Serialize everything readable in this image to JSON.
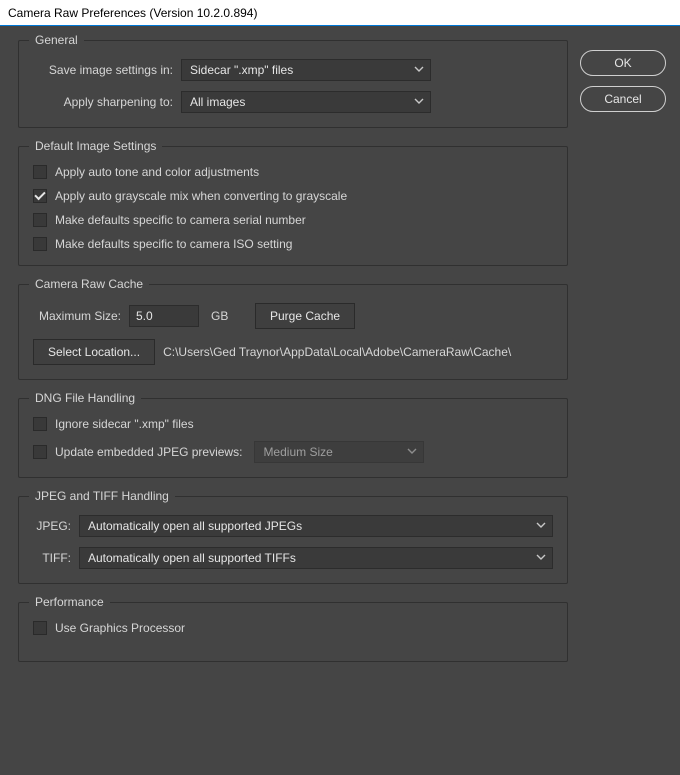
{
  "window": {
    "title": "Camera Raw Preferences  (Version 10.2.0.894)"
  },
  "buttons": {
    "ok": "OK",
    "cancel": "Cancel"
  },
  "general": {
    "legend": "General",
    "save_label": "Save image settings in:",
    "save_value": "Sidecar \".xmp\" files",
    "sharpen_label": "Apply sharpening to:",
    "sharpen_value": "All images"
  },
  "defaults": {
    "legend": "Default Image Settings",
    "auto_tone": "Apply auto tone and color adjustments",
    "auto_gray": "Apply auto grayscale mix when converting to grayscale",
    "specific_serial": "Make defaults specific to camera serial number",
    "specific_iso": "Make defaults specific to camera ISO setting",
    "checked": {
      "auto_tone": false,
      "auto_gray": true,
      "specific_serial": false,
      "specific_iso": false
    }
  },
  "cache": {
    "legend": "Camera Raw Cache",
    "max_size_label": "Maximum Size:",
    "max_size_value": "5.0",
    "unit": "GB",
    "purge": "Purge Cache",
    "select_location": "Select Location...",
    "path": "C:\\Users\\Ged Traynor\\AppData\\Local\\Adobe\\CameraRaw\\Cache\\"
  },
  "dng": {
    "legend": "DNG File Handling",
    "ignore_sidecar": "Ignore sidecar \".xmp\" files",
    "update_previews_label": "Update embedded JPEG previews:",
    "update_previews_value": "Medium Size",
    "checked": {
      "ignore_sidecar": false,
      "update_previews": false
    }
  },
  "jpeg_tiff": {
    "legend": "JPEG and TIFF Handling",
    "jpeg_label": "JPEG:",
    "jpeg_value": "Automatically open all supported JPEGs",
    "tiff_label": "TIFF:",
    "tiff_value": "Automatically open all supported TIFFs"
  },
  "perf": {
    "legend": "Performance",
    "use_gpu": "Use Graphics Processor",
    "checked": {
      "use_gpu": false
    }
  }
}
